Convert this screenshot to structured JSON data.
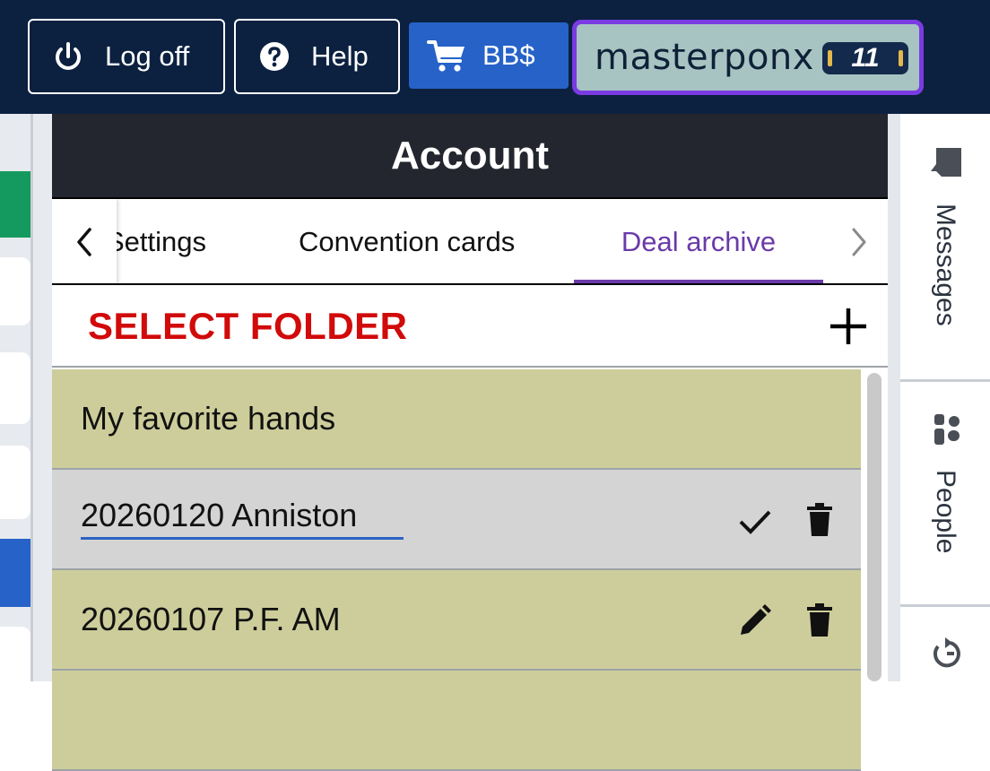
{
  "topbar": {
    "logoff_label": "Log off",
    "help_label": "Help",
    "bb_label": "BB$",
    "username": "masterponx",
    "badge_value": "11"
  },
  "panel": {
    "title": "Account",
    "tabs": [
      {
        "label": "Settings",
        "active": false
      },
      {
        "label": "Convention cards",
        "active": false
      },
      {
        "label": "Deal archive",
        "active": true
      }
    ],
    "folder_heading": "SELECT FOLDER",
    "folders": [
      {
        "name": "My favorite hands",
        "state": "default"
      },
      {
        "name": "20260120 Anniston",
        "state": "editing"
      },
      {
        "name": "20260107 P.F. AM",
        "state": "default"
      }
    ]
  },
  "rail": {
    "items": [
      {
        "label": "Messages",
        "icon": "chat-icon"
      },
      {
        "label": "People",
        "icon": "people-icon"
      },
      {
        "icon": "refresh-icon"
      }
    ]
  },
  "colors": {
    "topbar": "#0c2140",
    "accent_purple": "#6a3aa8",
    "heading_red": "#d10a0a",
    "row_olive": "#cdcd9b",
    "bb_button": "#2662c8"
  }
}
